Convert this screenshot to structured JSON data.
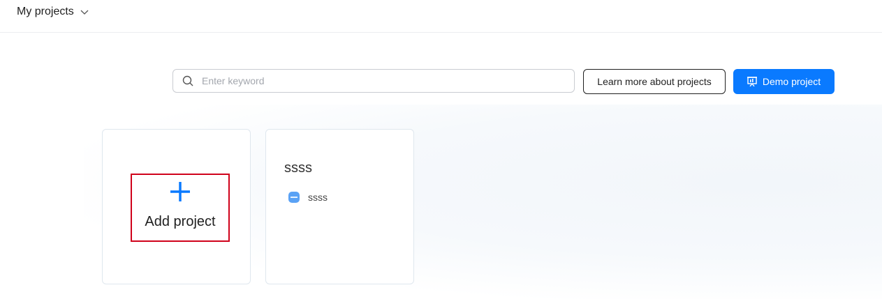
{
  "header": {
    "project_switcher_label": "My projects"
  },
  "search": {
    "placeholder": "Enter keyword",
    "value": ""
  },
  "actions": {
    "learn_more_label": "Learn more about projects",
    "demo_label": "Demo project"
  },
  "cards": {
    "add": {
      "label": "Add project"
    },
    "project": {
      "title": "ssss",
      "subtitle": "ssss"
    }
  },
  "colors": {
    "primary": "#0a7aff",
    "highlight_border": "#d0021b",
    "card_border": "#dfe7ee",
    "project_icon": "#5aa2f5"
  },
  "icons": {
    "chevron": "chevron-down-icon",
    "search": "search-icon",
    "demo": "presentation-icon",
    "add": "plus-icon",
    "project": "project-icon"
  }
}
